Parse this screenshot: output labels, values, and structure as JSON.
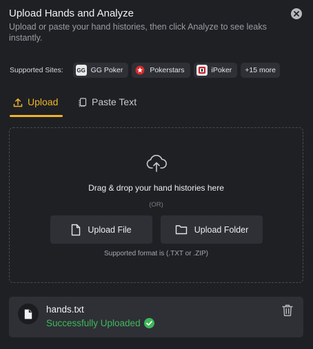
{
  "header": {
    "title": "Upload Hands and Analyze",
    "subtitle": "Upload or paste your hand histories, then click Analyze to see leaks instantly.",
    "close_icon": "close-icon"
  },
  "supported_sites": {
    "label": "Supported Sites:",
    "sites": [
      {
        "name": "GG Poker",
        "logo_text": "GG",
        "icon": "ggpoker-logo"
      },
      {
        "name": "Pokerstars",
        "icon": "pokerstars-logo"
      },
      {
        "name": "iPoker",
        "icon": "ipoker-logo"
      }
    ],
    "more_label": "+15 more"
  },
  "tabs": [
    {
      "label": "Upload",
      "icon": "upload-icon",
      "active": true
    },
    {
      "label": "Paste Text",
      "icon": "paste-icon",
      "active": false
    }
  ],
  "dropzone": {
    "icon": "cloud-upload-icon",
    "title": "Drag & drop your hand histories here",
    "or_text": "(OR)",
    "upload_file_label": "Upload File",
    "upload_folder_label": "Upload Folder",
    "format_hint": "Supported format is (.TXT or .ZIP)"
  },
  "uploaded_file": {
    "name": "hands.txt",
    "status": "Successfully Uploaded",
    "status_color": "#3fb75a",
    "icon": "file-icon"
  },
  "colors": {
    "background": "#1f2024",
    "accent": "#f0b429",
    "surface": "#2e3036",
    "success": "#3fb75a"
  }
}
